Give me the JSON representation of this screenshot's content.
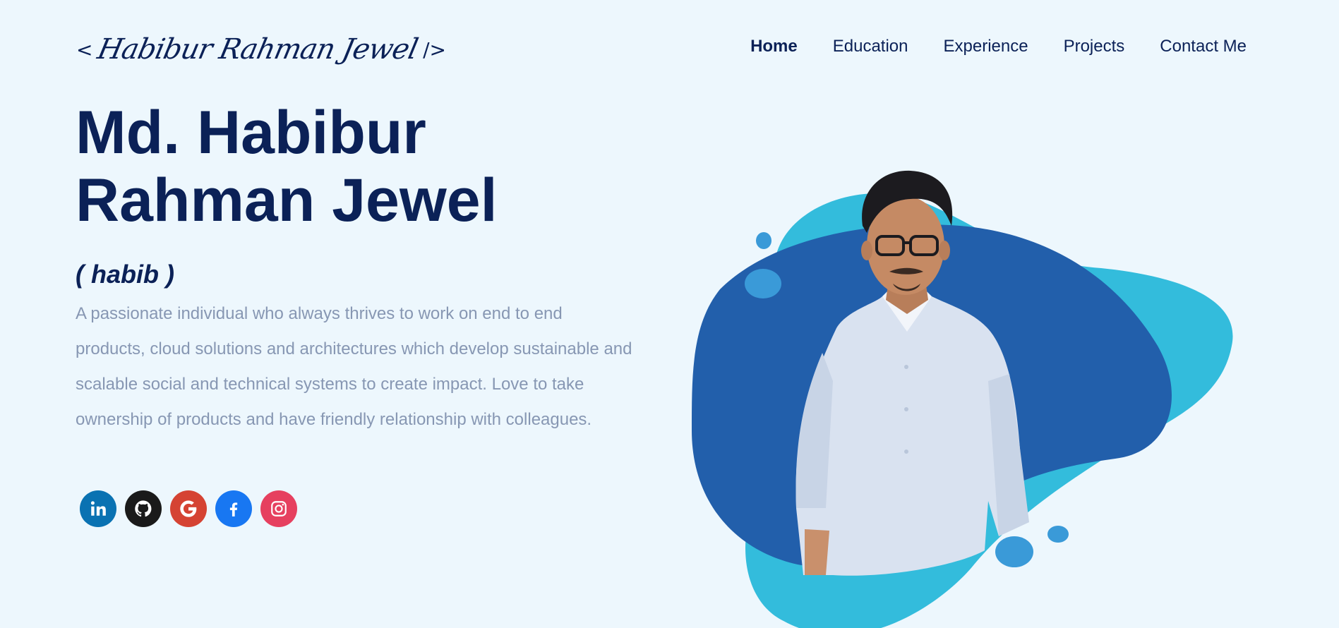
{
  "logo": {
    "open": "<",
    "signature": "Habibur Rahman Jewel",
    "close": "/>"
  },
  "nav": {
    "items": [
      {
        "label": "Home",
        "active": true
      },
      {
        "label": "Education",
        "active": false
      },
      {
        "label": "Experience",
        "active": false
      },
      {
        "label": "Projects",
        "active": false
      },
      {
        "label": "Contact Me",
        "active": false
      }
    ]
  },
  "hero": {
    "name_line1": "Md. Habibur",
    "name_line2": "Rahman Jewel",
    "nickname": "( habib )",
    "bio": "A passionate individual who always thrives to work on end to end products, cloud solutions and architectures which develop sustainable and scalable social and technical systems to create impact. Love to take ownership of products and have friendly relationship with colleagues."
  },
  "socials": [
    {
      "name": "linkedin-icon",
      "color": "#0a72b2"
    },
    {
      "name": "github-icon",
      "color": "#1a1a1a"
    },
    {
      "name": "google-icon",
      "color": "#d54333"
    },
    {
      "name": "facebook-icon",
      "color": "#1877f2"
    },
    {
      "name": "instagram-icon",
      "color": "#e6405f"
    }
  ],
  "colors": {
    "background": "#edf7fd",
    "text_dark": "#0b2157",
    "text_muted": "#8797b3",
    "blob_light": "#33bcdc",
    "blob_dark": "#225fab",
    "bubble": "#3a9ad8"
  }
}
